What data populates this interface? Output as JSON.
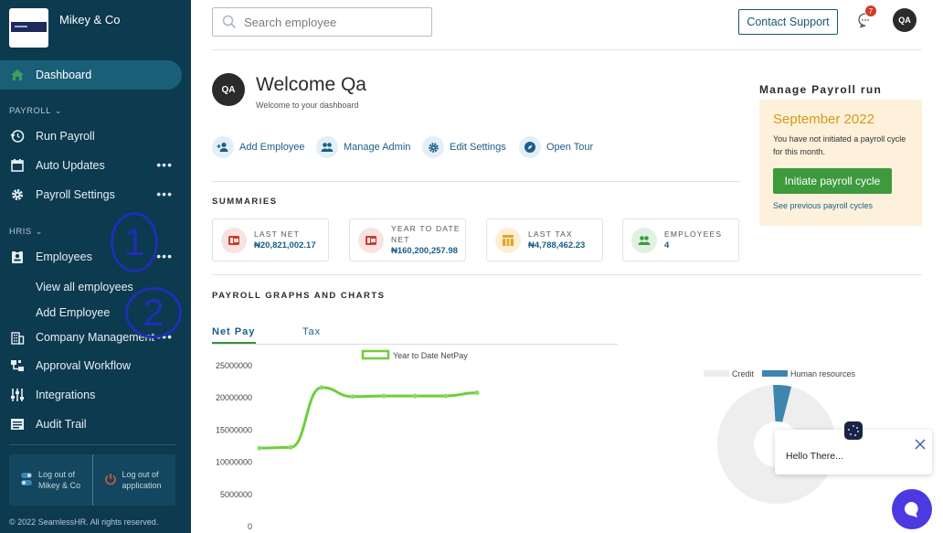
{
  "brand": {
    "name": "Mikey & Co"
  },
  "sidebar": {
    "dashboard": "Dashboard",
    "payroll_section": "PAYROLL",
    "payroll_items": [
      "Run Payroll",
      "Auto Updates",
      "Payroll Settings"
    ],
    "hris_section": "HRIS",
    "employees": "Employees",
    "employee_subitems": [
      "View all employees",
      "Add Employee"
    ],
    "hris_items": [
      "Company Management",
      "Approval Workflow",
      "Integrations",
      "Audit Trail"
    ],
    "logout_company": "Log out of Mikey & Co",
    "logout_app": "Log out of application",
    "copyright": "© 2022 SeamlessHR. All rights reserved.",
    "annotations": [
      "1",
      "2"
    ]
  },
  "header": {
    "search_placeholder": "Search employee",
    "contact_support": "Contact Support",
    "notification_count": "7",
    "user_initials": "QA"
  },
  "welcome": {
    "initials": "QA",
    "title": "Welcome Qa",
    "subtitle": "Welcome to your dashboard"
  },
  "quick_actions": [
    "Add Employee",
    "Manage Admin",
    "Edit Settings",
    "Open Tour"
  ],
  "summaries": {
    "title": "SUMMARIES",
    "cards": [
      {
        "label": "LAST NET",
        "value": "₦20,821,002.17"
      },
      {
        "label": "YEAR TO DATE NET",
        "value": "₦160,200,257.98"
      },
      {
        "label": "LAST TAX",
        "value": "₦4,788,462.23"
      },
      {
        "label": "EMPLOYEES",
        "value": "4"
      }
    ]
  },
  "graphs": {
    "title": "PAYROLL GRAPHS AND CHARTS",
    "tabs": [
      "Net Pay",
      "Tax"
    ],
    "active_tab": "Net Pay"
  },
  "payroll_run": {
    "title": "Manage Payroll run",
    "month": "September 2022",
    "message": "You have not initiated a payroll cycle for this month.",
    "button": "Initiate payroll cycle",
    "link": "See previous payroll cycles"
  },
  "chat": {
    "message": "Hello There..."
  },
  "colors": {
    "sidebar": "#0c3a4f",
    "accent": "#1a5e87",
    "primary_button": "#3d9a3d",
    "line": "#6dcf3a",
    "donut_hr": "#3e86ae",
    "donut_credit": "#eeeeee"
  },
  "chart_data": [
    {
      "type": "line",
      "legend": [
        "Year to Date NetPay"
      ],
      "yticks": [
        "25000000",
        "20000000",
        "15000000",
        "10000000",
        "5000000",
        "0"
      ],
      "ylim": [
        0,
        25000000
      ],
      "series": [
        {
          "name": "Year to Date NetPay",
          "values": [
            12200000,
            12300000,
            21600000,
            20200000,
            20300000,
            20300000,
            20300000,
            20800000
          ]
        }
      ]
    },
    {
      "type": "pie",
      "legend": [
        "Credit",
        "Human resources"
      ],
      "series": [
        {
          "name": "",
          "values": [
            95,
            5
          ]
        }
      ],
      "categories": [
        "Credit",
        "Human resources"
      ]
    }
  ]
}
